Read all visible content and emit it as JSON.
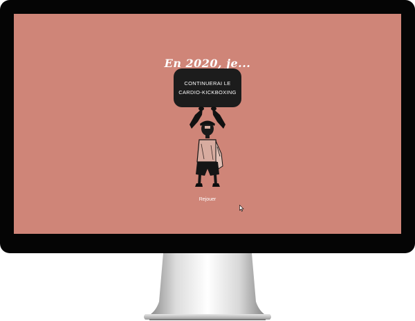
{
  "colors": {
    "screen_bg": "#CF8578",
    "bezel": "#050505",
    "card_bg": "#1C1C1C",
    "text_light": "#FFFFFF"
  },
  "page": {
    "headline": "En 2020, je...",
    "resolution_line1": "CONTINUERAI LE",
    "resolution_line2": "CARDIO-KICKBOXING",
    "replay_label": "Rejouer"
  },
  "icons": {
    "illustration": "person-carrying-sign-illustration",
    "cursor": "mouse-pointer-icon"
  }
}
